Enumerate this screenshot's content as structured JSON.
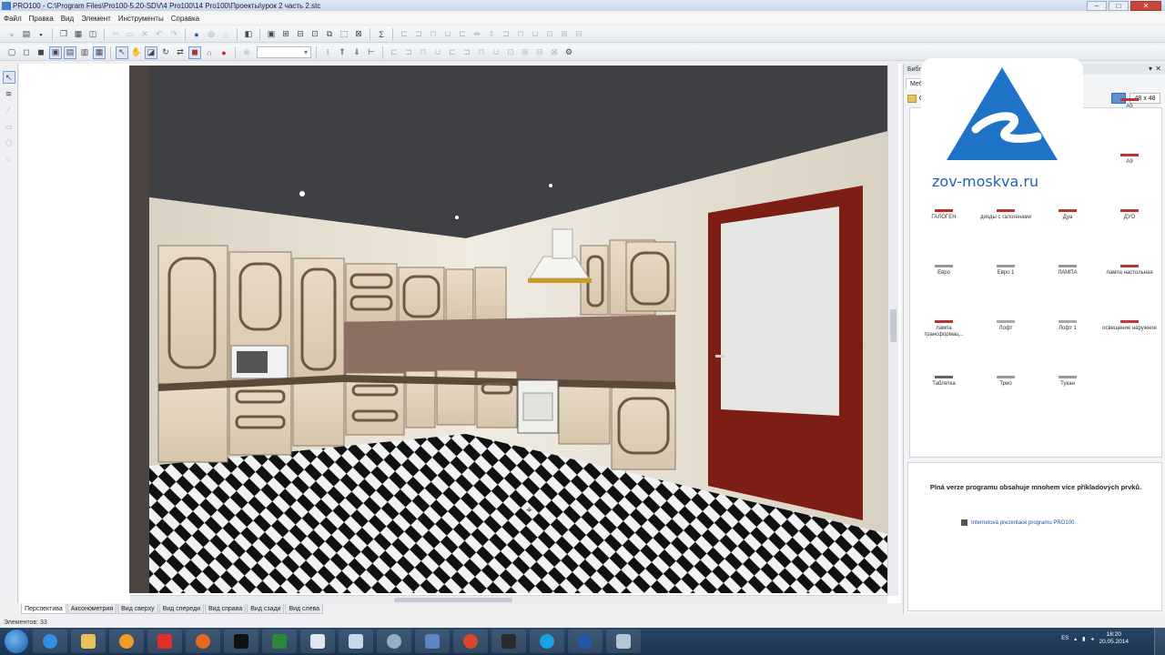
{
  "window": {
    "title": "PRO100 - C:\\Program Files\\Pro100-5.20-SDV\\4 Pro100\\14 Pro100\\Проекты\\урок 2 часть 2.stc",
    "minimize": "–",
    "maximize": "□",
    "close": "✕"
  },
  "menu": [
    "Файл",
    "Правка",
    "Вид",
    "Элемент",
    "Инструменты",
    "Справка"
  ],
  "zoom_value": "▾",
  "view_tabs": [
    "Перспектива",
    "Аксонометрия",
    "Вид сверху",
    "Вид спереди",
    "Вид справа",
    "Вид сзади",
    "Вид слева"
  ],
  "status": "Элементов: 33",
  "panel": {
    "header": "Библиотека",
    "tab": "Мебель",
    "folder_label": "Ос",
    "size_selector": "48 x 48"
  },
  "logo": {
    "site": "zov-moskva.ru"
  },
  "library_items": [
    {
      "label": "А5",
      "icon": "cross-rail-icon"
    },
    {
      "label": "А6",
      "icon": "handle-icon"
    },
    {
      "label": "А8",
      "icon": "bar-icon"
    },
    {
      "label": "А9",
      "icon": "hook-icon"
    },
    {
      "label": "ГАЛОГЕН",
      "icon": "halogen-lamp-icon"
    },
    {
      "label": "диоды с галогенами",
      "icon": "diode-icon"
    },
    {
      "label": "Дуа",
      "icon": "handle-icon"
    },
    {
      "label": "ДУО",
      "icon": "handle-icon"
    },
    {
      "label": "Евро",
      "icon": "lamp-arm-icon"
    },
    {
      "label": "Евро 1",
      "icon": "lamp-arm-icon"
    },
    {
      "label": "ЛАМПА",
      "icon": "lamp-pole-icon"
    },
    {
      "label": "лампа настольная",
      "icon": "table-lamp-icon"
    },
    {
      "label": "лампа трансформац...",
      "icon": "floor-lamp-icon"
    },
    {
      "label": "Лофт",
      "icon": "spotlight-icon"
    },
    {
      "label": "Лофт 1",
      "icon": "spotlight-icon"
    },
    {
      "label": "освещение наружное",
      "icon": "outdoor-light-icon"
    },
    {
      "label": "Таблетка",
      "icon": "disc-lamp-icon"
    },
    {
      "label": "Трио",
      "icon": "lamp-arm-icon"
    },
    {
      "label": "Тукан",
      "icon": "lamp-arm-icon"
    }
  ],
  "notice": {
    "message": "Plná verze programu obsahuje mnohem více příkladových prvků.",
    "link": "Internetová prezentace programu PRO100"
  },
  "tray": {
    "lang": "ES",
    "time": "18:20",
    "date": "20.05.2014"
  }
}
